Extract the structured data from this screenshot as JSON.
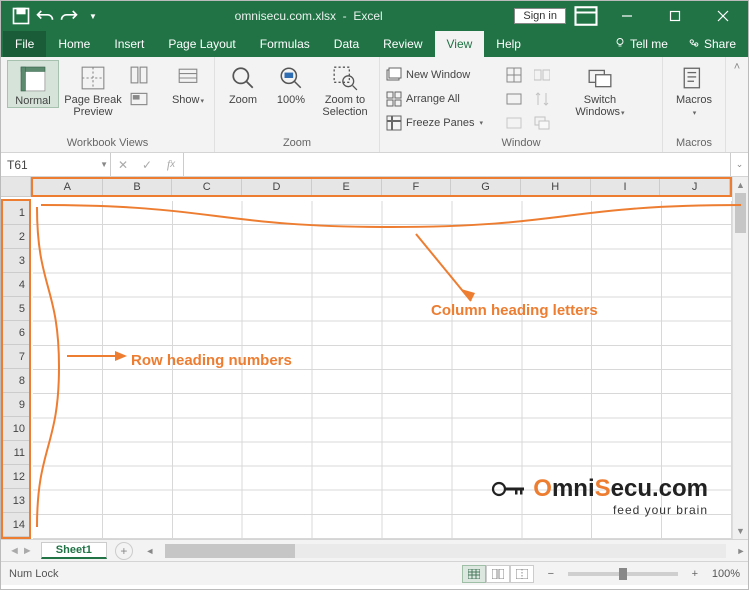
{
  "titlebar": {
    "document": "omnisecu.com.xlsx",
    "app": "Excel",
    "signin": "Sign in"
  },
  "tabs": {
    "file": "File",
    "items": [
      "Home",
      "Insert",
      "Page Layout",
      "Formulas",
      "Data",
      "Review",
      "View",
      "Help"
    ],
    "active": "View",
    "tellme": "Tell me",
    "share": "Share"
  },
  "ribbon": {
    "workbook_views": {
      "label": "Workbook Views",
      "normal": "Normal",
      "page_break": "Page Break\nPreview",
      "show": "Show"
    },
    "zoom": {
      "label": "Zoom",
      "zoom": "Zoom",
      "hundred": "100%",
      "to_selection": "Zoom to\nSelection"
    },
    "window": {
      "label": "Window",
      "new_window": "New Window",
      "arrange_all": "Arrange All",
      "freeze_panes": "Freeze Panes",
      "switch": "Switch\nWindows"
    },
    "macros": {
      "label": "Macros",
      "macros": "Macros"
    }
  },
  "namebox": "T61",
  "columns": [
    "A",
    "B",
    "C",
    "D",
    "E",
    "F",
    "G",
    "H",
    "I",
    "J"
  ],
  "rows": [
    "1",
    "2",
    "3",
    "4",
    "5",
    "6",
    "7",
    "8",
    "9",
    "10",
    "11",
    "12",
    "13",
    "14"
  ],
  "annotations": {
    "col": "Column heading letters",
    "row": "Row heading numbers"
  },
  "sheets": {
    "active": "Sheet1"
  },
  "status": {
    "numlock": "Num Lock",
    "zoom": "100%"
  },
  "logo": {
    "brand_left": "O",
    "brand_mid": "mni",
    "brand_accent": "S",
    "brand_right": "ecu.com",
    "tag": "feed your brain"
  }
}
